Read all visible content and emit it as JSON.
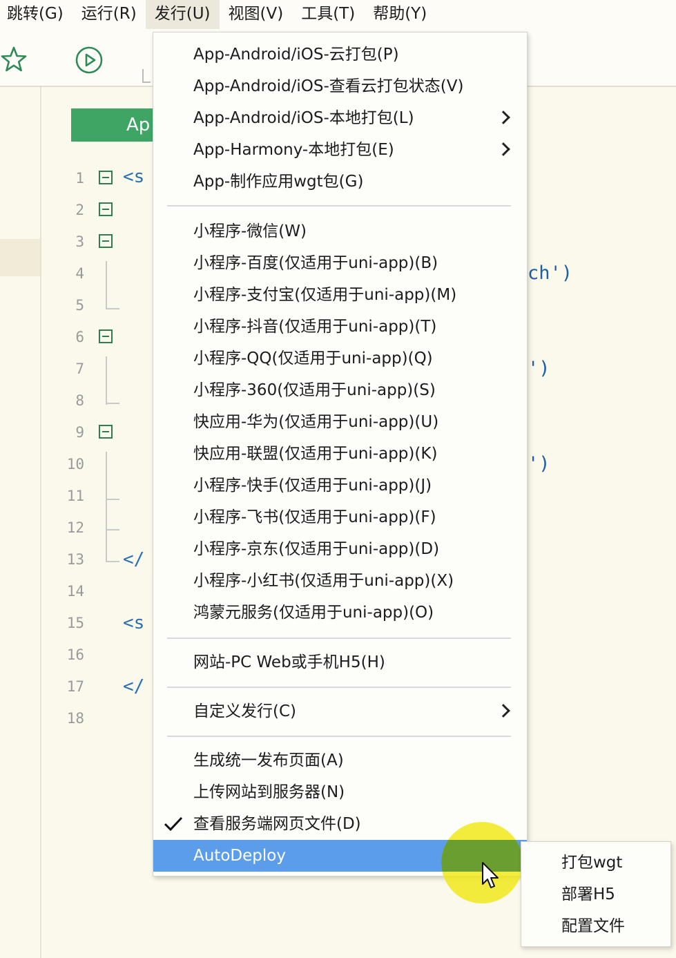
{
  "menubar": {
    "items": [
      "跳转(G)",
      "运行(R)",
      "发行(U)",
      "视图(V)",
      "工具(T)",
      "帮助(Y)"
    ]
  },
  "editor": {
    "app_button_label": "Ap",
    "line_numbers": [
      "1",
      "2",
      "3",
      "4",
      "5",
      "6",
      "7",
      "8",
      "9",
      "10",
      "11",
      "12",
      "13",
      "14",
      "15",
      "16",
      "17",
      "18"
    ],
    "code_fragments": {
      "l1": "<s",
      "l13": "</",
      "l15": "<s",
      "l17": "</"
    },
    "right_fragments": {
      "l4": "ch')",
      "l7": "')",
      "l10": "')"
    }
  },
  "menu": {
    "group1": [
      {
        "label": "App-Android/iOS-云打包(P)",
        "submenu": false
      },
      {
        "label": "App-Android/iOS-查看云打包状态(V)",
        "submenu": false
      },
      {
        "label": "App-Android/iOS-本地打包(L)",
        "submenu": true
      },
      {
        "label": "App-Harmony-本地打包(E)",
        "submenu": true
      },
      {
        "label": "App-制作应用wgt包(G)",
        "submenu": false
      }
    ],
    "group2": [
      "小程序-微信(W)",
      "小程序-百度(仅适用于uni-app)(B)",
      "小程序-支付宝(仅适用于uni-app)(M)",
      "小程序-抖音(仅适用于uni-app)(T)",
      "小程序-QQ(仅适用于uni-app)(Q)",
      "小程序-360(仅适用于uni-app)(S)",
      "快应用-华为(仅适用于uni-app)(U)",
      "快应用-联盟(仅适用于uni-app)(K)",
      "小程序-快手(仅适用于uni-app)(J)",
      "小程序-飞书(仅适用于uni-app)(F)",
      "小程序-京东(仅适用于uni-app)(D)",
      "小程序-小红书(仅适用于uni-app)(X)",
      "鸿蒙元服务(仅适用于uni-app)(O)"
    ],
    "web": "网站-PC Web或手机H5(H)",
    "custom": "自定义发行(C)",
    "group5": {
      "generate": "生成统一发布页面(A)",
      "upload": "上传网站到服务器(N)",
      "view_files": "查看服务端网页文件(D)",
      "view_files_checked": true,
      "autodeploy": "AutoDeploy"
    }
  },
  "submenu": {
    "items": [
      "打包wgt",
      "部署H5",
      "配置文件"
    ]
  },
  "colors": {
    "highlight": "#5b9de8",
    "app_button": "#3fa564",
    "cursor_highlight": "#f0e814"
  }
}
